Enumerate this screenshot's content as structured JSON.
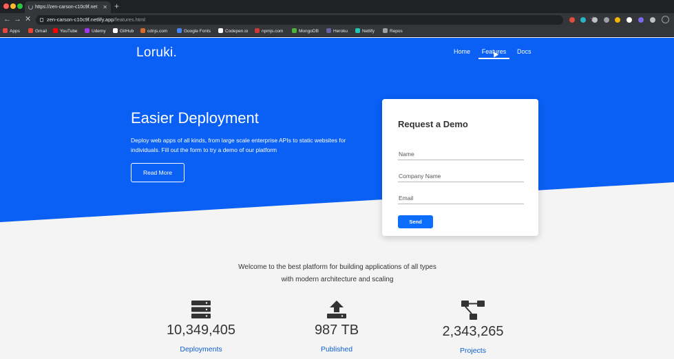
{
  "browser": {
    "tab_title": "https://zen-carson-c10c9f.net",
    "url_host": "zen-carson-c10c9f.netlify.app",
    "url_path": "/features.html",
    "bookmarks": [
      {
        "label": "Apps",
        "color": "#e8453c"
      },
      {
        "label": "Gmail",
        "color": "#ea4335"
      },
      {
        "label": "YouTube",
        "color": "#ff0000"
      },
      {
        "label": "Udemy",
        "color": "#a435f0"
      },
      {
        "label": "GitHub",
        "color": "#ffffff"
      },
      {
        "label": "cdnjs.com",
        "color": "#d96a2b"
      },
      {
        "label": "Google Fonts",
        "color": "#4285f4"
      },
      {
        "label": "Codepen.io",
        "color": "#ffffff"
      },
      {
        "label": "npmjs.com",
        "color": "#cb3837"
      },
      {
        "label": "MongoDB",
        "color": "#4db33d"
      },
      {
        "label": "Heroku",
        "color": "#6762a6"
      },
      {
        "label": "Netlify",
        "color": "#20c6b7"
      },
      {
        "label": "Repos",
        "color": "#9aa0a6"
      }
    ]
  },
  "site": {
    "logo": "Loruki.",
    "nav": [
      {
        "label": "Home"
      },
      {
        "label": "Features"
      },
      {
        "label": "Docs"
      }
    ],
    "hero": {
      "title": "Easier Deployment",
      "text": "Deploy web apps of all kinds, from large scale enterprise APIs to static websites for individuals. Fill out the form to try a demo of our platform",
      "button": "Read More"
    },
    "form": {
      "title": "Request a Demo",
      "fields": [
        {
          "placeholder": "Name"
        },
        {
          "placeholder": "Company Name"
        },
        {
          "placeholder": "Email"
        }
      ],
      "submit": "Send"
    },
    "welcome": "Welcome to the best platform for building applications of all types with modern architecture and scaling",
    "stats": [
      {
        "value": "10,349,405",
        "label": "Deployments",
        "icon": "server-icon"
      },
      {
        "value": "987 TB",
        "label": "Published",
        "icon": "upload-icon"
      },
      {
        "value": "2,343,265",
        "label": "Projects",
        "icon": "project-diagram-icon"
      }
    ]
  },
  "colors": {
    "primary": "#0a5ff5",
    "button": "#0d6efd",
    "stat_label": "#0b5ed7"
  }
}
